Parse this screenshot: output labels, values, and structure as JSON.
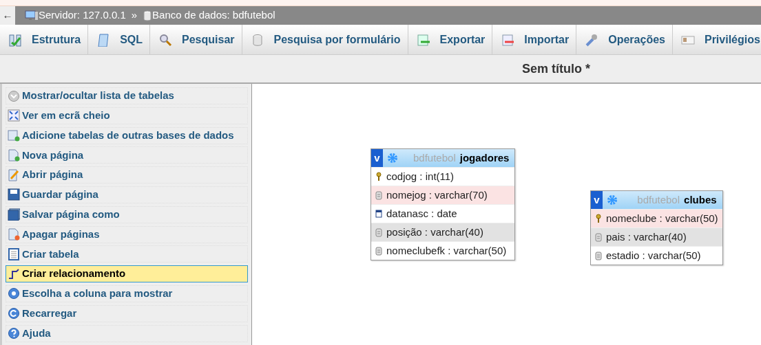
{
  "breadcrumb": {
    "back": "←",
    "server": "Servidor: 127.0.0.1",
    "separator": "»",
    "database": "Banco de dados: bdfutebol"
  },
  "tabs": [
    {
      "label": "Estrutura",
      "selected": false
    },
    {
      "label": "SQL",
      "selected": false
    },
    {
      "label": "Pesquisar",
      "selected": false
    },
    {
      "label": "Pesquisa por formulário",
      "selected": false
    },
    {
      "label": "Exportar",
      "selected": false
    },
    {
      "label": "Importar",
      "selected": false
    },
    {
      "label": "Operações",
      "selected": false
    },
    {
      "label": "Privilégios",
      "selected": false
    }
  ],
  "page_title": "Sem título *",
  "sidebar": {
    "items": [
      {
        "label": "Mostrar/ocultar lista de tabelas",
        "selected": false
      },
      {
        "label": "Ver em ecrã cheio",
        "selected": false
      },
      {
        "label": "Adicione tabelas de outras bases de dados",
        "selected": false
      },
      {
        "label": "Nova página",
        "selected": false
      },
      {
        "label": "Abrir página",
        "selected": false
      },
      {
        "label": "Guardar página",
        "selected": false
      },
      {
        "label": "Salvar página como",
        "selected": false
      },
      {
        "label": "Apagar páginas",
        "selected": false
      },
      {
        "label": "Criar tabela",
        "selected": false
      },
      {
        "label": "Criar relacionamento",
        "selected": true
      },
      {
        "label": "Escolha a coluna para mostrar",
        "selected": false
      },
      {
        "label": "Recarregar",
        "selected": false
      },
      {
        "label": "Ajuda",
        "selected": false
      }
    ]
  },
  "tables": [
    {
      "toggle": "v",
      "database": "bdfutebol",
      "name": "jogadores",
      "columns": [
        {
          "text": "codjog : int(11)",
          "kind": "key",
          "highlighted": false,
          "selected": false
        },
        {
          "text": "nomejog : varchar(70)",
          "kind": "text",
          "highlighted": true,
          "selected": false
        },
        {
          "text": "datanasc : date",
          "kind": "date",
          "highlighted": false,
          "selected": false
        },
        {
          "text": "posição : varchar(40)",
          "kind": "text",
          "highlighted": false,
          "selected": true
        },
        {
          "text": "nomeclubefk : varchar(50)",
          "kind": "text",
          "highlighted": false,
          "selected": false
        }
      ]
    },
    {
      "toggle": "v",
      "database": "bdfutebol",
      "name": "clubes",
      "columns": [
        {
          "text": "nomeclube : varchar(50)",
          "kind": "key",
          "highlighted": true,
          "selected": false
        },
        {
          "text": "pais : varchar(40)",
          "kind": "text",
          "highlighted": false,
          "selected": true
        },
        {
          "text": "estadio : varchar(50)",
          "kind": "text",
          "highlighted": false,
          "selected": false
        }
      ]
    }
  ]
}
